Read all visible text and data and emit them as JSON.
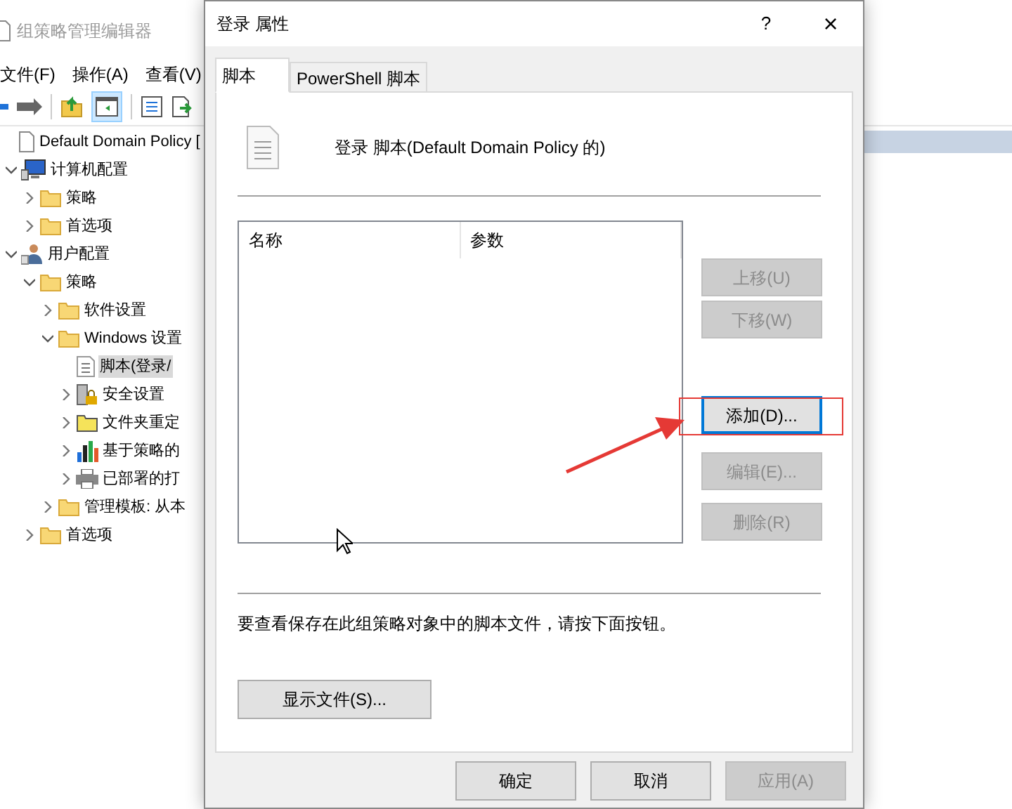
{
  "main_window": {
    "title": "组策略管理编辑器",
    "menu": [
      "文件(F)",
      "操作(A)",
      "查看(V)"
    ],
    "tree": [
      {
        "label": "Default Domain Policy [",
        "kind": "policy",
        "selected": false,
        "children": [
          {
            "label": "计算机配置",
            "kind": "computer",
            "expanded": true,
            "selected": false,
            "children": [
              {
                "label": "策略",
                "kind": "folder",
                "expanded": false,
                "selected": false
              },
              {
                "label": "首选项",
                "kind": "folder",
                "expanded": false,
                "selected": false
              }
            ]
          },
          {
            "label": "用户配置",
            "kind": "user",
            "expanded": true,
            "selected": false,
            "children": [
              {
                "label": "策略",
                "kind": "folder",
                "expanded": true,
                "selected": false,
                "children": [
                  {
                    "label": "软件设置",
                    "kind": "folder",
                    "expanded": false,
                    "selected": false
                  },
                  {
                    "label": "Windows 设置",
                    "kind": "folder",
                    "expanded": true,
                    "selected": false,
                    "children": [
                      {
                        "label": "脚本(登录/",
                        "kind": "script",
                        "selected": true
                      },
                      {
                        "label": "安全设置",
                        "kind": "security",
                        "expanded": false,
                        "selected": false
                      },
                      {
                        "label": "文件夹重定",
                        "kind": "redirect",
                        "expanded": false,
                        "selected": false
                      },
                      {
                        "label": "基于策略的",
                        "kind": "chart",
                        "expanded": false,
                        "selected": false
                      },
                      {
                        "label": "已部署的打",
                        "kind": "printer",
                        "expanded": false,
                        "selected": false
                      }
                    ]
                  },
                  {
                    "label": "管理模板: 从本",
                    "kind": "folder",
                    "expanded": false,
                    "selected": false
                  }
                ]
              },
              {
                "label": "首选项",
                "kind": "folder",
                "expanded": false,
                "selected": false
              }
            ]
          }
        ]
      }
    ]
  },
  "dialog": {
    "title": "登录 属性",
    "help": "?",
    "close": "×",
    "tabs": [
      {
        "label": "脚本",
        "selected": true
      },
      {
        "label": "PowerShell 脚本",
        "selected": false
      }
    ],
    "heading": "登录 脚本(Default Domain Policy 的)",
    "table": {
      "columns": [
        "名称",
        "参数"
      ]
    },
    "side_buttons": [
      {
        "label": "上移(U)",
        "disabled": true,
        "focused": false
      },
      {
        "label": "下移(W)",
        "disabled": true,
        "focused": false
      },
      {
        "label": "添加(D)...",
        "disabled": false,
        "focused": true
      },
      {
        "label": "编辑(E)...",
        "disabled": true,
        "focused": false
      },
      {
        "label": "删除(R)",
        "disabled": true,
        "focused": false
      }
    ],
    "hint": "要查看保存在此组策略对象中的脚本文件，请按下面按钮。",
    "show_files_button": "显示文件(S)...",
    "buttons": [
      {
        "label": "确定",
        "disabled": false
      },
      {
        "label": "取消",
        "disabled": false
      },
      {
        "label": "应用(A)",
        "disabled": true
      }
    ]
  }
}
